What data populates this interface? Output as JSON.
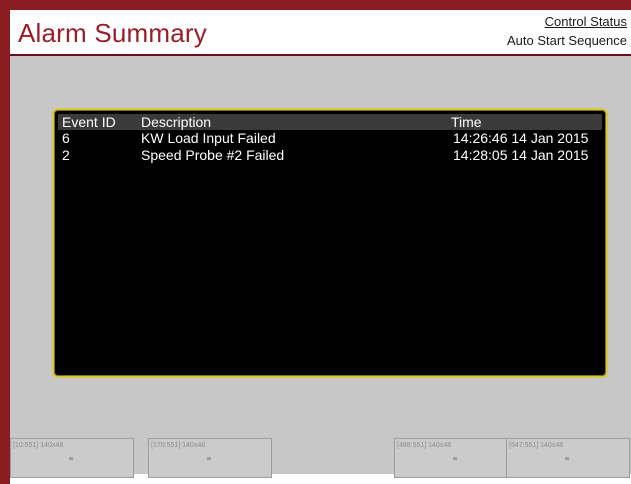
{
  "header": {
    "title": "Alarm Summary",
    "status_link": "Control Status",
    "sequence": "Auto Start Sequence"
  },
  "table": {
    "columns": [
      "Event ID",
      "Description",
      "Time"
    ],
    "rows": [
      {
        "id": "6",
        "description": "KW Load Input Failed",
        "time": "14:26:46 14 Jan 2015"
      },
      {
        "id": "2",
        "description": "Speed Probe #2 Failed",
        "time": "14:28:05 14 Jan 2015"
      }
    ]
  },
  "softkeys": [
    {
      "label": "[10:551] 140x48"
    },
    {
      "label": "[170:551] 140x48"
    },
    {
      "label": "[488:551] 140x48"
    },
    {
      "label": "[647:551] 140x48"
    }
  ],
  "colors": {
    "brand_red": "#8c1c24",
    "panel_border": "#d8c840"
  }
}
